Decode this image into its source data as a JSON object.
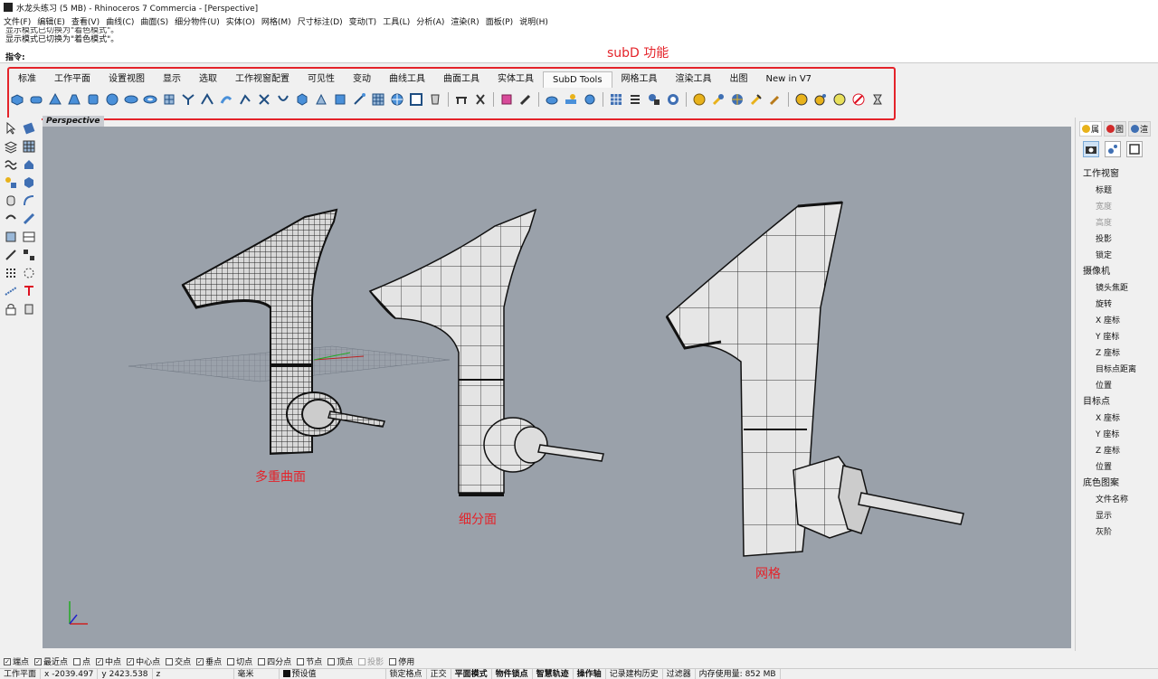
{
  "window": {
    "title": "水龙头练习 (5 MB) - Rhinoceros 7 Commercia - [Perspective]"
  },
  "menu": [
    "文件(F)",
    "编辑(E)",
    "查看(V)",
    "曲线(C)",
    "曲面(S)",
    "细分物件(U)",
    "实体(O)",
    "网格(M)",
    "尺寸标注(D)",
    "变动(T)",
    "工具(L)",
    "分析(A)",
    "渲染(R)",
    "面板(P)",
    "说明(H)"
  ],
  "command_history": {
    "line1": "显示模式已切换为\"着色模式\"。",
    "line2": "显示模式已切换为\"着色模式\"。"
  },
  "command_prompt": "指令:",
  "toolbar": {
    "annotation": "subD 功能",
    "tabs": [
      "标准",
      "工作平面",
      "设置视图",
      "显示",
      "选取",
      "工作视窗配置",
      "可见性",
      "变动",
      "曲线工具",
      "曲面工具",
      "实体工具",
      "SubD Tools",
      "网格工具",
      "渲染工具",
      "出图",
      "New in V7"
    ],
    "active_tab": "SubD Tools"
  },
  "viewport": {
    "label": "Perspective",
    "background": "#9aa1aa",
    "annotations": {
      "multisurface": "多重曲面",
      "subd": "细分面",
      "mesh": "网格"
    }
  },
  "right_panel": {
    "tabs": [
      "属",
      "图",
      "渲"
    ],
    "sections": [
      {
        "title": "工作视窗",
        "items": [
          {
            "label": "标题",
            "dim": false
          },
          {
            "label": "宽度",
            "dim": true
          },
          {
            "label": "高度",
            "dim": true
          },
          {
            "label": "投影",
            "dim": false
          },
          {
            "label": "锁定",
            "dim": false
          }
        ]
      },
      {
        "title": "摄像机",
        "items": [
          {
            "label": "镜头焦距",
            "dim": false
          },
          {
            "label": "旋转",
            "dim": false
          },
          {
            "label": "X 座标",
            "dim": false
          },
          {
            "label": "Y 座标",
            "dim": false
          },
          {
            "label": "Z 座标",
            "dim": false
          },
          {
            "label": "目标点距离",
            "dim": false
          },
          {
            "label": "位置",
            "dim": false
          }
        ]
      },
      {
        "title": "目标点",
        "items": [
          {
            "label": "X 座标",
            "dim": false
          },
          {
            "label": "Y 座标",
            "dim": false
          },
          {
            "label": "Z 座标",
            "dim": false
          },
          {
            "label": "位置",
            "dim": false
          }
        ]
      },
      {
        "title": "底色图案",
        "items": [
          {
            "label": "文件名称",
            "dim": false
          },
          {
            "label": "显示",
            "dim": false
          },
          {
            "label": "灰阶",
            "dim": false
          }
        ]
      }
    ]
  },
  "osnaps": [
    {
      "label": "端点",
      "checked": true,
      "dim": false
    },
    {
      "label": "最近点",
      "checked": true,
      "dim": false
    },
    {
      "label": "点",
      "checked": false,
      "dim": false
    },
    {
      "label": "中点",
      "checked": true,
      "dim": false
    },
    {
      "label": "中心点",
      "checked": true,
      "dim": false
    },
    {
      "label": "交点",
      "checked": false,
      "dim": false
    },
    {
      "label": "垂点",
      "checked": true,
      "dim": false
    },
    {
      "label": "切点",
      "checked": false,
      "dim": false
    },
    {
      "label": "四分点",
      "checked": false,
      "dim": false
    },
    {
      "label": "节点",
      "checked": false,
      "dim": false
    },
    {
      "label": "顶点",
      "checked": false,
      "dim": false
    },
    {
      "label": "投影",
      "checked": false,
      "dim": true
    },
    {
      "label": "停用",
      "checked": false,
      "dim": false
    }
  ],
  "status": {
    "cplane": "工作平面",
    "x": "x -2039.497",
    "y": "y 2423.538",
    "z": "z",
    "units": "毫米",
    "layer": "预设值",
    "grid_snap": "锁定格点",
    "ortho": "正交",
    "planar": "平面模式",
    "osnap": "物件锁点",
    "smarttrack": "智慧轨迹",
    "gumball": "操作轴",
    "history": "记录建构历史",
    "filter": "过滤器",
    "memory": "内存使用量: 852 MB"
  },
  "colors": {
    "accent_red": "#e4232a",
    "viewport_bg": "#9aa1aa"
  }
}
